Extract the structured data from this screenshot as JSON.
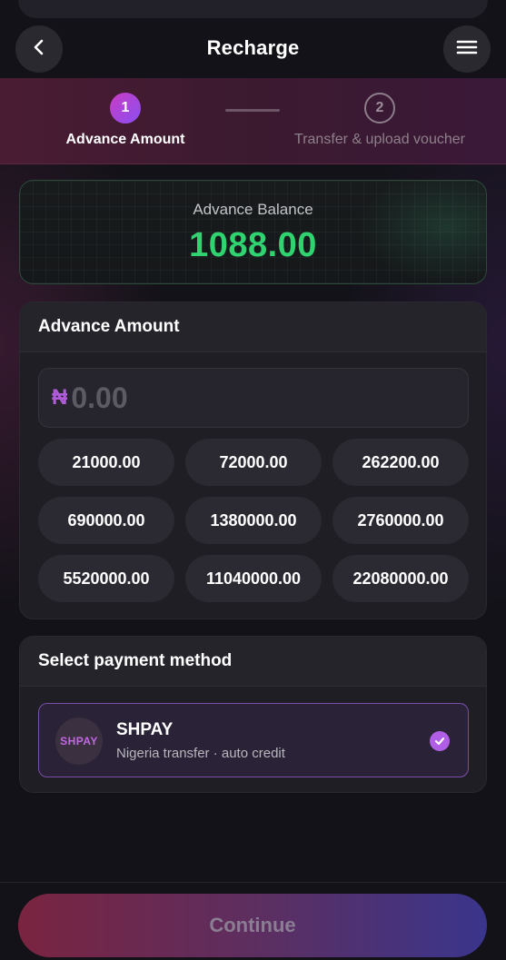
{
  "header": {
    "title": "Recharge",
    "back_icon": "chevron-left-icon",
    "menu_icon": "hamburger-menu-icon"
  },
  "stepper": {
    "steps": [
      {
        "number": "1",
        "label": "Advance Amount",
        "active": true
      },
      {
        "number": "2",
        "label": "Transfer & upload voucher",
        "active": false
      }
    ]
  },
  "balance": {
    "label": "Advance Balance",
    "value": "1088.00",
    "color": "#2fd36f"
  },
  "amount": {
    "title": "Advance Amount",
    "currency_symbol": "₦",
    "placeholder": "0.00",
    "value": "",
    "presets": [
      "21000.00",
      "72000.00",
      "262200.00",
      "690000.00",
      "1380000.00",
      "2760000.00",
      "5520000.00",
      "11040000.00",
      "22080000.00"
    ]
  },
  "payment": {
    "title": "Select payment method",
    "methods": [
      {
        "logo": "SHPAY",
        "name": "SHPAY",
        "description": "Nigeria transfer · auto credit",
        "selected": true
      }
    ]
  },
  "footer": {
    "continue_label": "Continue"
  },
  "colors": {
    "accent": "#b15ee6",
    "background": "#131218"
  }
}
